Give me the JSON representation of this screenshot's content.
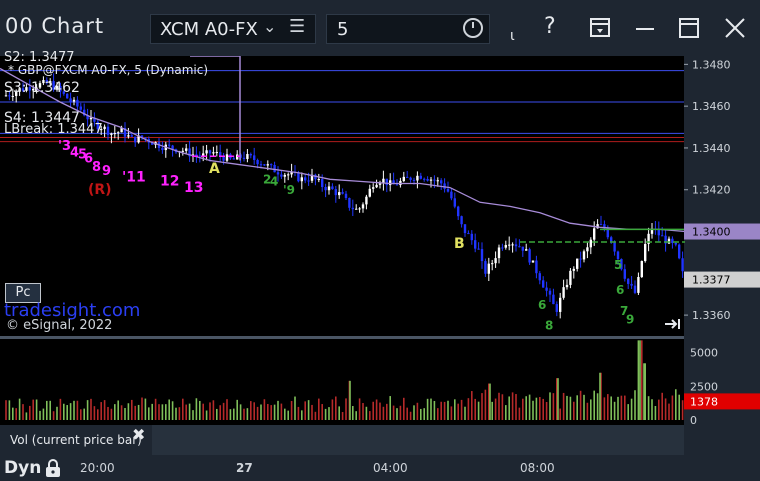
{
  "app": {
    "title": "00 Chart",
    "symbol": "XCM A0-FX",
    "interval": "5"
  },
  "toolbar": {
    "tool_icons": [
      "link-icon",
      "help-icon",
      "layout-icon",
      "minimize-icon",
      "restore-icon",
      "close-icon"
    ]
  },
  "overlay": {
    "study_label": "* GBP@FXCM A0-FX, 5 (Dynamic)",
    "s2": "S2: 1.3477",
    "s3": "S3: 1.3462",
    "s4": "S4: 1.3447",
    "lbreak": "LBreak: 1.3447",
    "pc_button": "Pc",
    "site": "tradesight.com",
    "copyright": "© eSignal, 2022"
  },
  "chart_data": {
    "type": "candlestick",
    "price_axis": {
      "ylim": [
        1.335,
        1.3484
      ],
      "ticks": [
        "1.3480",
        "1.3460",
        "1.3440",
        "1.3420",
        "1.3400",
        "1.3360"
      ],
      "tick_values": [
        1.348,
        1.346,
        1.344,
        1.342,
        1.34,
        1.336
      ]
    },
    "last_price_badges": [
      {
        "label": "1.3400",
        "value": 1.34,
        "color": "#9a85c7"
      },
      {
        "label": "1.3377",
        "value": 1.3377,
        "color": "#d0d0d0"
      }
    ],
    "pivot_lines": [
      {
        "value": 1.3477,
        "color": "#3d4ef0"
      },
      {
        "value": 1.3462,
        "color": "#3d4ef0"
      },
      {
        "value": 1.3447,
        "color": "#3d4ef0"
      },
      {
        "value": 1.3445,
        "color": "#b11d1d"
      },
      {
        "value": 1.3443,
        "color": "#b11d1d"
      }
    ],
    "moving_average": {
      "color": "#a78bd8",
      "points": [
        [
          0,
          1.3478
        ],
        [
          30,
          1.347
        ],
        [
          60,
          1.3462
        ],
        [
          90,
          1.3455
        ],
        [
          120,
          1.345
        ],
        [
          150,
          1.3443
        ],
        [
          180,
          1.3438
        ],
        [
          210,
          1.3434
        ],
        [
          240,
          1.3432
        ],
        [
          270,
          1.343
        ],
        [
          300,
          1.3428
        ],
        [
          330,
          1.3425
        ],
        [
          360,
          1.3424
        ],
        [
          390,
          1.3423
        ],
        [
          420,
          1.3423
        ],
        [
          450,
          1.3421
        ],
        [
          480,
          1.3414
        ],
        [
          510,
          1.3412
        ],
        [
          540,
          1.3409
        ],
        [
          570,
          1.3404
        ],
        [
          600,
          1.3402
        ],
        [
          630,
          1.3401
        ],
        [
          660,
          1.3401
        ],
        [
          685,
          1.34
        ]
      ]
    },
    "price_path": [
      [
        5,
        1.3465
      ],
      [
        20,
        1.3468
      ],
      [
        35,
        1.347
      ],
      [
        50,
        1.3471
      ],
      [
        62,
        1.3466
      ],
      [
        72,
        1.3462
      ],
      [
        82,
        1.3458
      ],
      [
        92,
        1.3452
      ],
      [
        102,
        1.345
      ],
      [
        112,
        1.3447
      ],
      [
        122,
        1.3448
      ],
      [
        132,
        1.3444
      ],
      [
        142,
        1.3445
      ],
      [
        152,
        1.3443
      ],
      [
        162,
        1.3441
      ],
      [
        172,
        1.344
      ],
      [
        182,
        1.3439
      ],
      [
        192,
        1.3437
      ],
      [
        202,
        1.3436
      ],
      [
        212,
        1.3438
      ],
      [
        222,
        1.3436
      ],
      [
        232,
        1.3434
      ],
      [
        242,
        1.3436
      ],
      [
        252,
        1.3435
      ],
      [
        262,
        1.3433
      ],
      [
        272,
        1.343
      ],
      [
        282,
        1.3428
      ],
      [
        292,
        1.3427
      ],
      [
        302,
        1.3425
      ],
      [
        312,
        1.3426
      ],
      [
        322,
        1.3422
      ],
      [
        332,
        1.342
      ],
      [
        342,
        1.3417
      ],
      [
        350,
        1.3412
      ],
      [
        358,
        1.341
      ],
      [
        366,
        1.3416
      ],
      [
        374,
        1.3424
      ],
      [
        382,
        1.3425
      ],
      [
        392,
        1.3422
      ],
      [
        402,
        1.3424
      ],
      [
        412,
        1.3426
      ],
      [
        422,
        1.3427
      ],
      [
        432,
        1.3425
      ],
      [
        442,
        1.3423
      ],
      [
        450,
        1.3418
      ],
      [
        456,
        1.3409
      ],
      [
        462,
        1.3402
      ],
      [
        470,
        1.3397
      ],
      [
        478,
        1.3392
      ],
      [
        484,
        1.338
      ],
      [
        492,
        1.3385
      ],
      [
        500,
        1.3393
      ],
      [
        508,
        1.3396
      ],
      [
        516,
        1.3394
      ],
      [
        524,
        1.3392
      ],
      [
        532,
        1.3385
      ],
      [
        540,
        1.3378
      ],
      [
        548,
        1.337
      ],
      [
        556,
        1.3362
      ],
      [
        564,
        1.3372
      ],
      [
        572,
        1.3382
      ],
      [
        580,
        1.3387
      ],
      [
        588,
        1.3392
      ],
      [
        596,
        1.3403
      ],
      [
        604,
        1.3402
      ],
      [
        612,
        1.3395
      ],
      [
        620,
        1.3385
      ],
      [
        628,
        1.3375
      ],
      [
        636,
        1.337
      ],
      [
        644,
        1.3392
      ],
      [
        652,
        1.3402
      ],
      [
        660,
        1.3398
      ],
      [
        668,
        1.3395
      ],
      [
        676,
        1.3392
      ],
      [
        684,
        1.3377
      ]
    ],
    "level_lines": [
      {
        "from": 192,
        "to": 240,
        "value": 1.3436,
        "color": "#ff22ff",
        "dash": true
      },
      {
        "from": 520,
        "to": 685,
        "value": 1.3395,
        "color": "#3aa83a",
        "dash": true
      },
      {
        "from": 600,
        "to": 685,
        "value": 1.3401,
        "color": "#3aa83a",
        "dash": false
      }
    ],
    "annotations": [
      {
        "text": "A",
        "x": 209,
        "y": 1.3428,
        "color": "#e0e060",
        "size": 14
      },
      {
        "text": "B",
        "x": 454,
        "y": 1.3392,
        "color": "#e0e060",
        "size": 14
      },
      {
        "text": "(R)",
        "x": 88,
        "y": 1.3418,
        "color": "#c01515",
        "size": 14
      },
      {
        "text": "'11",
        "x": 122,
        "y": 1.3424,
        "color": "#ff22ff",
        "size": 14
      },
      {
        "text": "12",
        "x": 160,
        "y": 1.3422,
        "color": "#ff22ff",
        "size": 14
      },
      {
        "text": "13",
        "x": 184,
        "y": 1.3419,
        "color": "#ff22ff",
        "size": 14
      },
      {
        "text": "'3",
        "x": 58,
        "y": 1.3439,
        "color": "#ff22ff",
        "size": 13
      },
      {
        "text": "4",
        "x": 70,
        "y": 1.3436,
        "color": "#ff22ff",
        "size": 13
      },
      {
        "text": "5",
        "x": 78,
        "y": 1.3435,
        "color": "#ff22ff",
        "size": 13
      },
      {
        "text": "6",
        "x": 84,
        "y": 1.3433,
        "color": "#ff22ff",
        "size": 13
      },
      {
        "text": "8",
        "x": 92,
        "y": 1.3429,
        "color": "#ff22ff",
        "size": 13
      },
      {
        "text": "9",
        "x": 102,
        "y": 1.3427,
        "color": "#ff22ff",
        "size": 13
      },
      {
        "text": "2",
        "x": 263,
        "y": 1.3423,
        "color": "#3aa83a",
        "size": 12
      },
      {
        "text": "4",
        "x": 270,
        "y": 1.3422,
        "color": "#3aa83a",
        "size": 12
      },
      {
        "text": "'9",
        "x": 283,
        "y": 1.3418,
        "color": "#3aa83a",
        "size": 12
      },
      {
        "text": "6",
        "x": 538,
        "y": 1.3363,
        "color": "#3aa83a",
        "size": 12
      },
      {
        "text": "8",
        "x": 545,
        "y": 1.3353,
        "color": "#3aa83a",
        "size": 12
      },
      {
        "text": "5",
        "x": 614,
        "y": 1.3382,
        "color": "#3aa83a",
        "size": 12
      },
      {
        "text": "6",
        "x": 616,
        "y": 1.337,
        "color": "#3aa83a",
        "size": 12
      },
      {
        "text": "7",
        "x": 620,
        "y": 1.336,
        "color": "#3aa83a",
        "size": 12
      },
      {
        "text": "9",
        "x": 626,
        "y": 1.3356,
        "color": "#3aa83a",
        "size": 12
      }
    ],
    "volume_axis": {
      "ylim": [
        0,
        6000
      ],
      "ticks": [
        "5000",
        "2500",
        "0"
      ],
      "tick_values": [
        5000,
        2500,
        0
      ],
      "badge": {
        "label": "1378",
        "value": 1378,
        "color": "#e00000"
      }
    },
    "volume_peaks": [
      {
        "x": 350,
        "value": 2900
      },
      {
        "x": 490,
        "value": 2700
      },
      {
        "x": 558,
        "value": 3100
      },
      {
        "x": 600,
        "value": 3500
      },
      {
        "x": 640,
        "value": 5900
      },
      {
        "x": 644,
        "value": 4200
      }
    ],
    "time_axis": {
      "labels": [
        "20:00",
        "27",
        "04:00",
        "08:00"
      ],
      "label_x": [
        80,
        236,
        373,
        520
      ]
    }
  },
  "volume_pane": {
    "label": "Vol (current price bar)"
  },
  "statusbar": {
    "mode": "Dyn"
  }
}
